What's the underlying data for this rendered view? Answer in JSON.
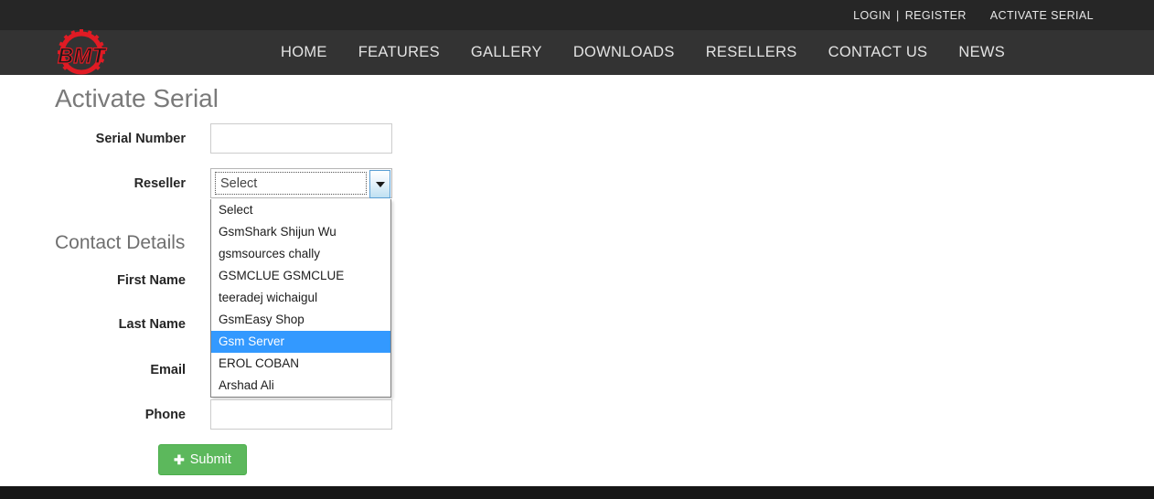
{
  "topbar": {
    "login": "LOGIN",
    "separator": "|",
    "register": "REGISTER",
    "activate_serial": "ACTIVATE SERIAL"
  },
  "brand": {
    "logo_text": "BMT",
    "logo_icon": "gear-logo-icon",
    "logo_color": "#e01b24"
  },
  "nav": {
    "items": [
      {
        "label": "HOME"
      },
      {
        "label": "FEATURES"
      },
      {
        "label": "GALLERY"
      },
      {
        "label": "DOWNLOADS"
      },
      {
        "label": "RESELLERS"
      },
      {
        "label": "CONTACT US"
      },
      {
        "label": "NEWS"
      }
    ]
  },
  "main": {
    "page_title": "Activate Serial",
    "section_title": "Contact Details",
    "fields": {
      "serial_number": {
        "label": "Serial Number",
        "value": "",
        "placeholder": ""
      },
      "reseller": {
        "label": "Reseller",
        "value": "Select"
      },
      "first_name": {
        "label": "First Name",
        "value": "",
        "placeholder": ""
      },
      "last_name": {
        "label": "Last Name",
        "value": "",
        "placeholder": ""
      },
      "email": {
        "label": "Email",
        "value": "",
        "placeholder": ""
      },
      "phone": {
        "label": "Phone",
        "value": "",
        "placeholder": ""
      }
    },
    "reseller_dropdown": {
      "open": true,
      "selected": "Gsm Server",
      "highlight_color": "#3399ff",
      "options": [
        "Select",
        "GsmShark Shijun Wu",
        "gsmsources chally",
        "GSMCLUE GSMCLUE",
        "teeradej wichaigul",
        "GsmEasy Shop",
        "Gsm Server",
        "EROL COBAN",
        "Arshad Ali"
      ]
    },
    "submit": {
      "label": "Submit",
      "icon": "plus-icon",
      "color": "#5cb85c"
    }
  },
  "colors": {
    "topbar_bg": "#262626",
    "navbar_bg": "#333333",
    "footer_bg": "#161616",
    "title_text": "#7a7a7a"
  }
}
